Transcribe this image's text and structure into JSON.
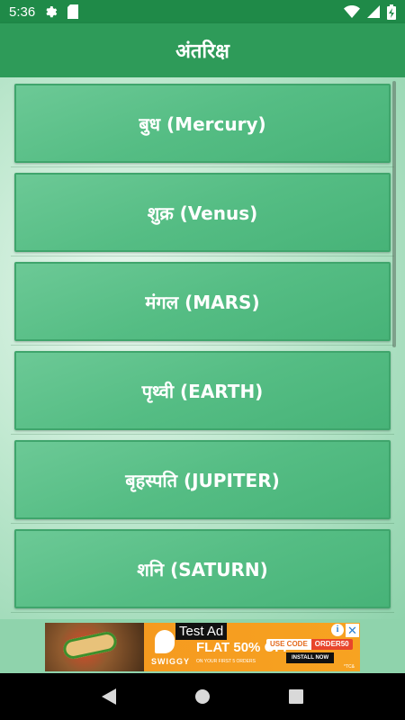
{
  "status_bar": {
    "time": "5:36"
  },
  "app_bar": {
    "title": "अंतरिक्ष"
  },
  "planets": [
    {
      "label": "बुध (Mercury)"
    },
    {
      "label": "शुक्र (Venus)"
    },
    {
      "label": "मंगल (MARS)"
    },
    {
      "label": "पृथ्वी (EARTH)"
    },
    {
      "label": "बृहस्पति (JUPITER)"
    },
    {
      "label": "शनि (SATURN)"
    }
  ],
  "ad": {
    "label": "Test Ad",
    "brand": "SWIGGY",
    "offer": "FLAT 50% OFF*",
    "subtext": "ON YOUR FIRST 5 ORDERS",
    "code_label": "USE CODE",
    "code_value": "ORDER50",
    "install": "INSTALL NOW",
    "terms": "*TC&",
    "info_icon": "i",
    "close_icon": "✕"
  },
  "colors": {
    "status_bar": "#1f8a48",
    "app_bar": "#2e9b59",
    "card": "#55bd84"
  }
}
